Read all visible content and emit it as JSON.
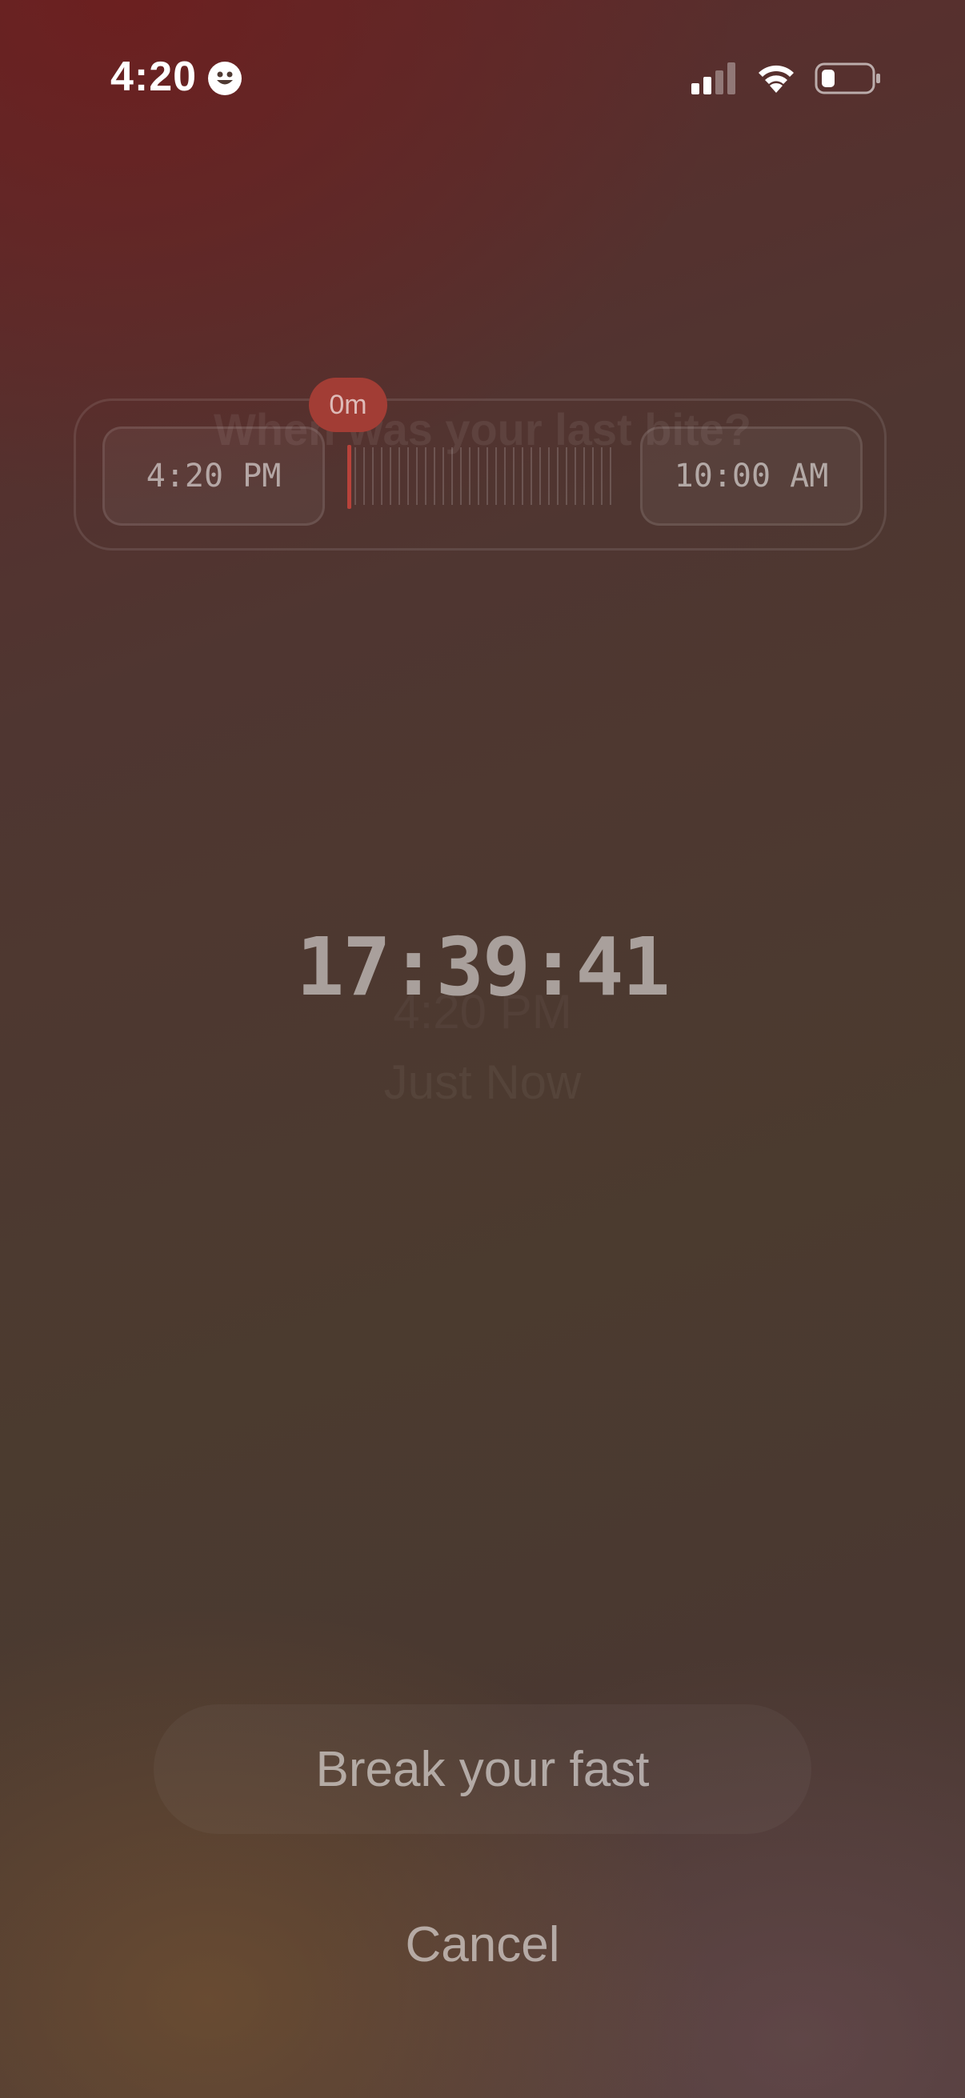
{
  "status_bar": {
    "time": "4:20",
    "icons": [
      "smiley-icon",
      "cellular-signal-icon",
      "wifi-icon",
      "battery-icon"
    ]
  },
  "picker": {
    "question": "When was your last bite?",
    "start_time": "4:20 PM",
    "end_time": "10:00 AM",
    "elapsed": "0m"
  },
  "timer": {
    "value": "17:39:41",
    "ghost_time": "4:20 PM",
    "ghost_relative": "Just Now"
  },
  "actions": {
    "break_label": "Break your fast",
    "cancel_label": "Cancel"
  },
  "colors": {
    "accent_red": "#a23d35",
    "background_top": "#5e2a2b",
    "background_bottom": "#4e3a38"
  }
}
